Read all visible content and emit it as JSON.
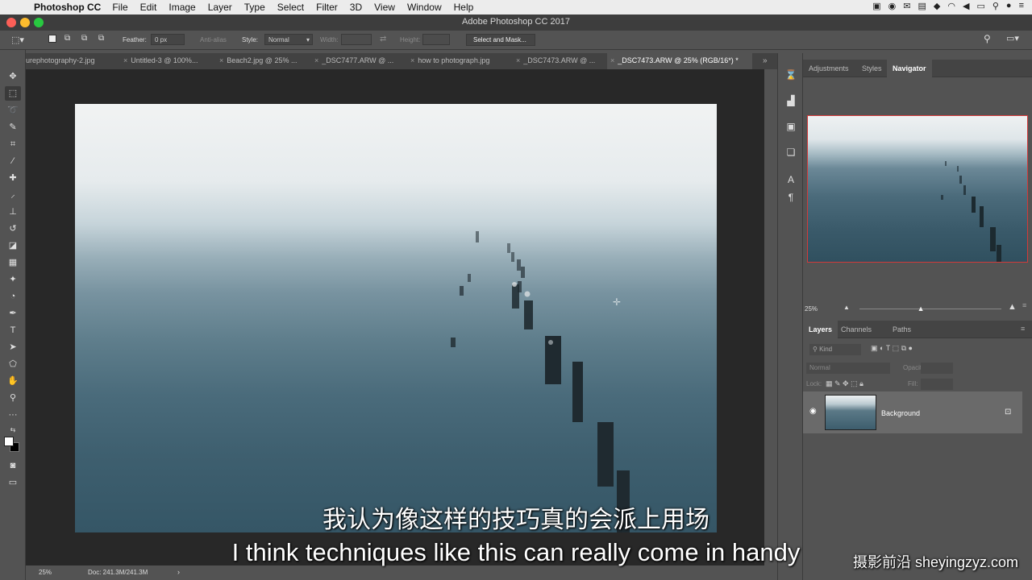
{
  "menubar": {
    "app_name": "Photoshop CC",
    "items": [
      "File",
      "Edit",
      "Image",
      "Layer",
      "Type",
      "Select",
      "Filter",
      "3D",
      "View",
      "Window",
      "Help"
    ]
  },
  "window": {
    "title": "Adobe Photoshop CC 2017"
  },
  "options_bar": {
    "feather_label": "Feather:",
    "feather_value": "0 px",
    "anti_alias_label": "Anti-alias",
    "style_label": "Style:",
    "style_value": "Normal",
    "width_label": "Width:",
    "height_label": "Height:",
    "select_mask_button": "Select and Mask..."
  },
  "document_tabs": [
    {
      "label": "urephotography-2.jpg",
      "active": false
    },
    {
      "label": "Untitled-3 @ 100%...",
      "active": false
    },
    {
      "label": "Beach2.jpg @ 25% ...",
      "active": false
    },
    {
      "label": "_DSC7477.ARW @ ...",
      "active": false
    },
    {
      "label": "how to photograph.jpg",
      "active": false
    },
    {
      "label": "_DSC7473.ARW @ ...",
      "active": false
    },
    {
      "label": "_DSC7473.ARW @ 25% (RGB/16*) *",
      "active": true
    }
  ],
  "status_bar": {
    "zoom": "25%",
    "doc_info": "Doc: 241.3M/241.3M"
  },
  "top_panel": {
    "tabs": [
      "Adjustments",
      "Styles",
      "Navigator"
    ],
    "active_tab": "Navigator",
    "zoom_value": "25%",
    "zoom_level": 0.43
  },
  "layers_panel": {
    "tabs": [
      "Layers",
      "Channels",
      "Paths"
    ],
    "active_tab": "Layers",
    "filter_placeholder": "Kind",
    "blend_mode": "Normal",
    "opacity_label": "Opacity:",
    "lock_label": "Lock:",
    "fill_label": "Fill:",
    "layers": [
      {
        "name": "Background",
        "locked": true,
        "visible": true
      }
    ]
  },
  "subtitles": {
    "chinese": "我认为像这样的技巧真的会派上用场",
    "english": "I think techniques like this can really come in handy"
  },
  "watermark": "摄影前沿 sheyingzyz.com",
  "colors": {
    "accent_red": "#d23a3a",
    "canvas_bg": "#282828",
    "ui_gray": "#535353"
  }
}
